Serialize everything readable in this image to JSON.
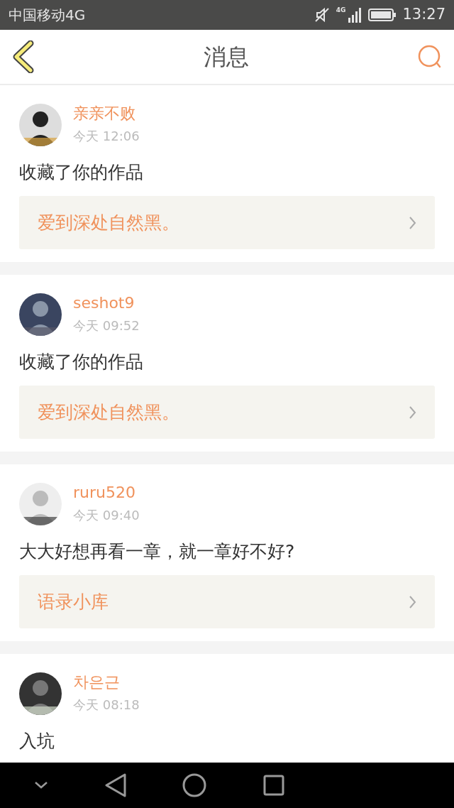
{
  "status_bar": {
    "carrier": "中国移动4G",
    "network": "4G",
    "time": "13:27"
  },
  "header": {
    "title": "消息"
  },
  "messages": [
    {
      "user": "亲亲不败",
      "time": "今天 12:06",
      "text": "收藏了你的作品",
      "link": "爱到深处自然黑。"
    },
    {
      "user": "seshot9",
      "time": "今天 09:52",
      "text": "收藏了你的作品",
      "link": "爱到深处自然黑。"
    },
    {
      "user": "ruru520",
      "time": "今天 09:40",
      "text": "大大好想再看一章，就一章好不好?",
      "link": "语录小库"
    },
    {
      "user": "차은근",
      "time": "今天 08:18",
      "text": "入坑"
    }
  ]
}
